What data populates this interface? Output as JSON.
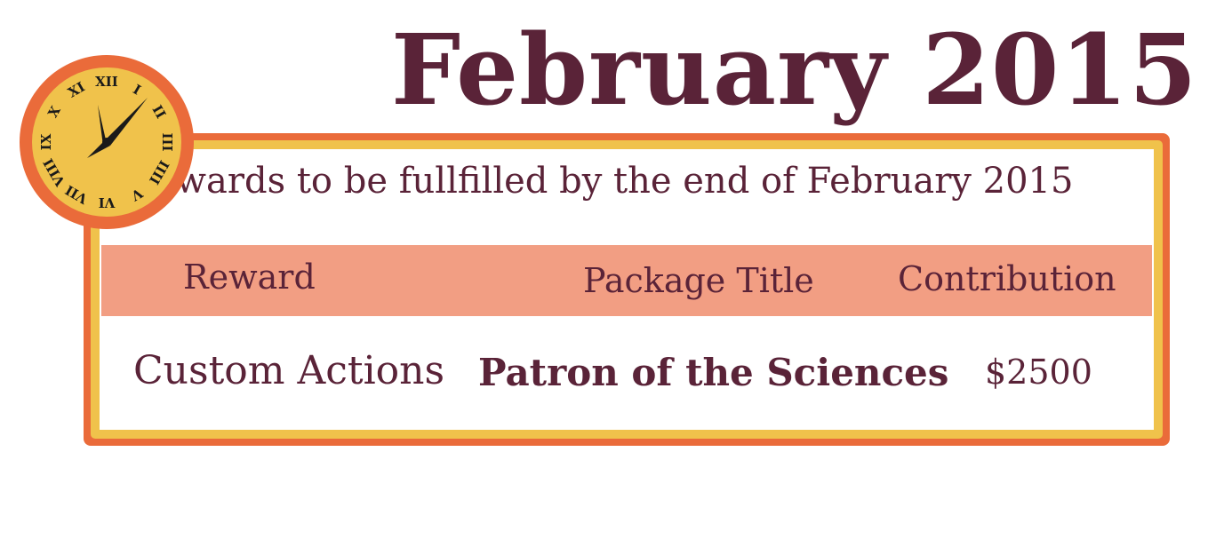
{
  "header": {
    "title": "February 2015",
    "subtitle": "Rewards to be fullfilled by the end of February 2015"
  },
  "table": {
    "columns": [
      "Reward",
      "Package Title",
      "Contribution"
    ],
    "rows": [
      [
        "Custom Actions",
        "Patron of the Sciences",
        "$2500"
      ]
    ]
  },
  "clock": {
    "icon": "roman-numeral-clock-icon",
    "numerals": [
      "XII",
      "I",
      "II",
      "III",
      "IIII",
      "V",
      "VI",
      "VII",
      "VIII",
      "IX",
      "X",
      "XI"
    ]
  },
  "colors": {
    "text": "#5a2338",
    "border_outer": "#ea6b3a",
    "border_inner": "#f0c24b",
    "header_bar": "#f29e83",
    "clock_face": "#f0c24b"
  }
}
